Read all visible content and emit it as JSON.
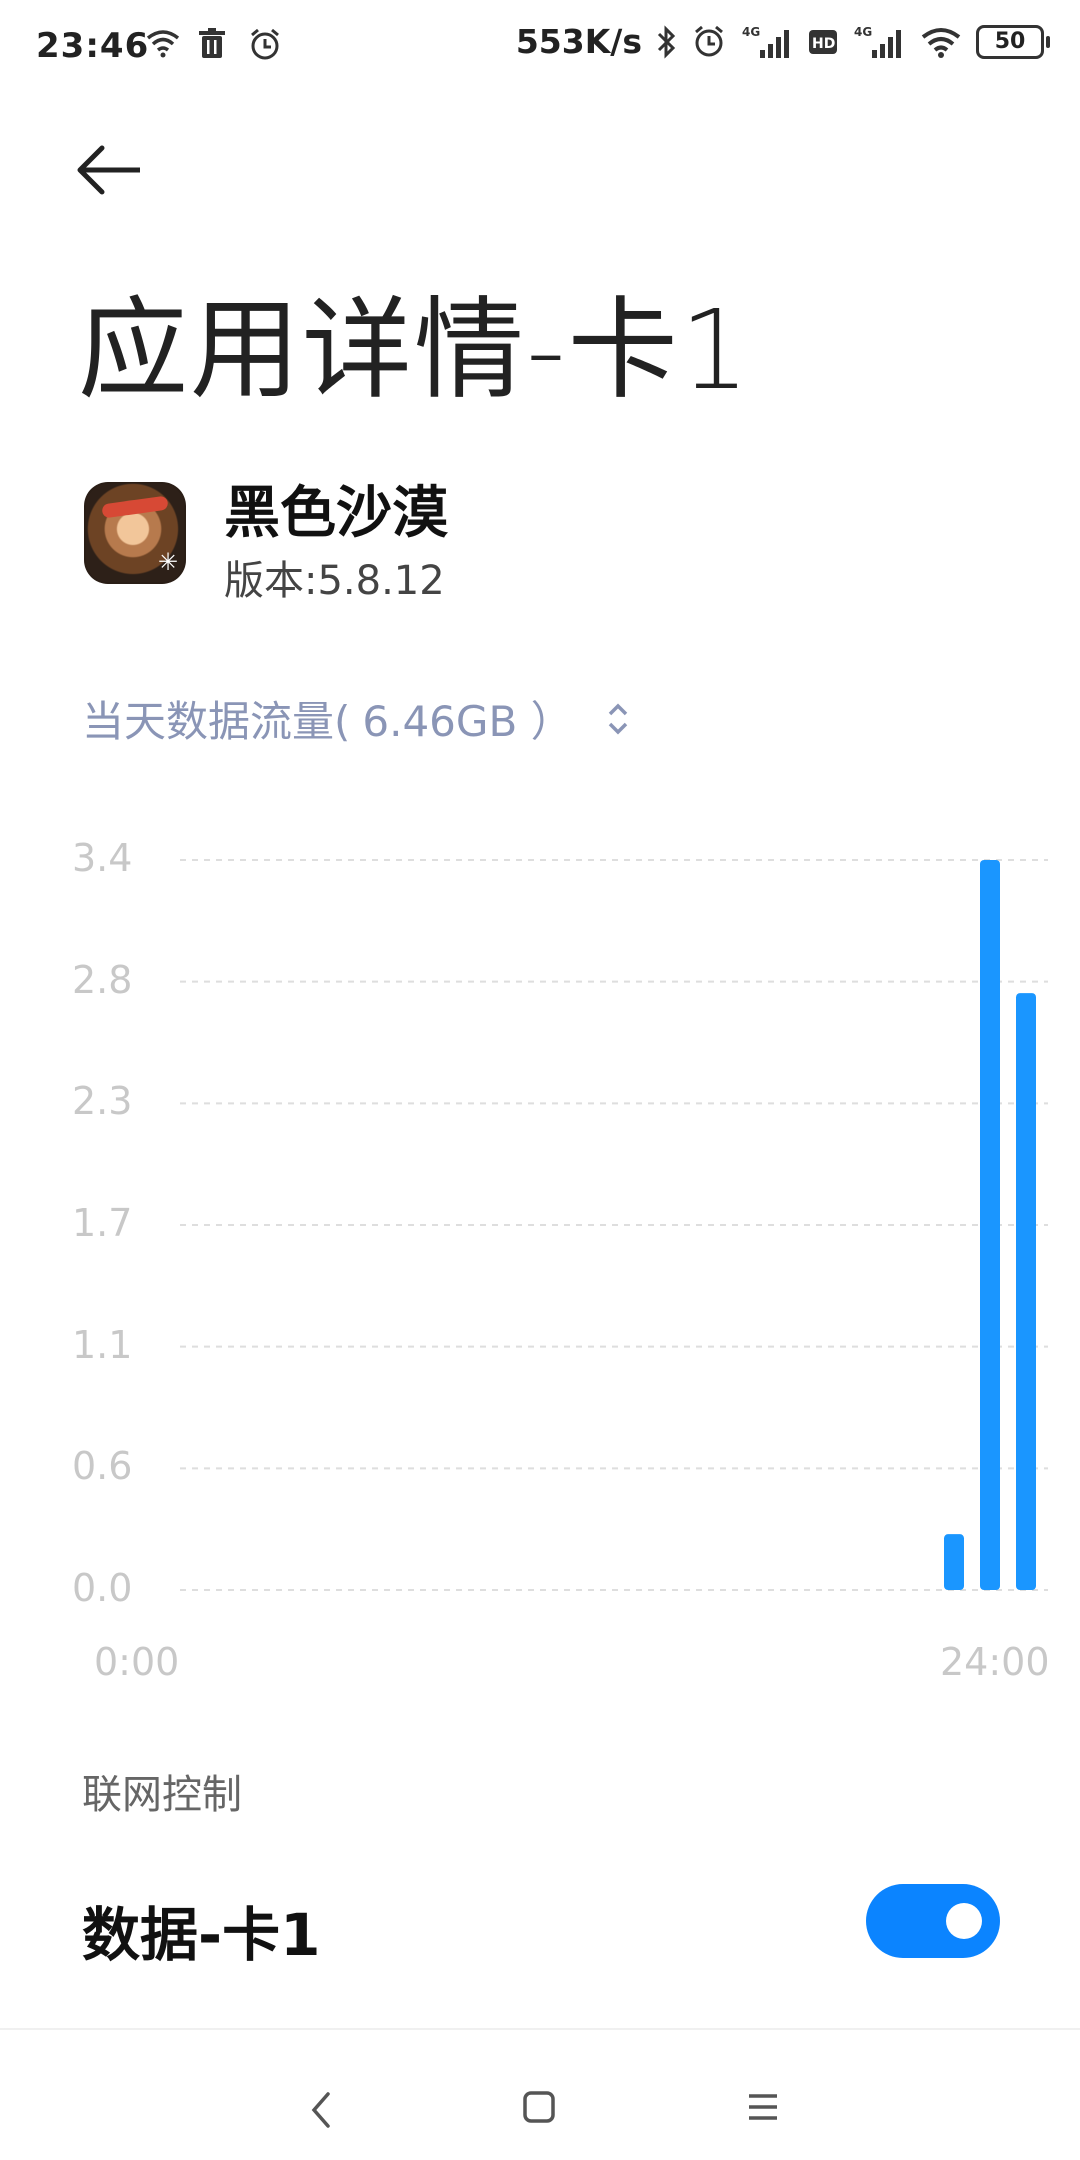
{
  "status_bar": {
    "time": "23:46",
    "left_icons": [
      "wifi-icon",
      "trash-icon",
      "alarm-icon"
    ],
    "net_speed": "553K/s",
    "right_icons": [
      "bluetooth-icon",
      "alarm-icon",
      "signal-4g-icon",
      "hd-icon",
      "signal-4g-icon",
      "wifi-icon"
    ],
    "battery": "50"
  },
  "page": {
    "back_icon": "back-arrow-icon",
    "title": "应用详情-卡1"
  },
  "app": {
    "name": "黑色沙漠",
    "version": "版本:5.8.12"
  },
  "usage": {
    "label": "当天数据流量(",
    "value": "6.46GB ）",
    "sort_icon": "sort-updown-icon"
  },
  "chart_data": {
    "type": "bar",
    "y_ticks": [
      "3.4",
      "2.8",
      "2.3",
      "1.7",
      "1.1",
      "0.6",
      "0.0"
    ],
    "x_ticks": [
      "0:00",
      "24:00"
    ],
    "ylim": [
      0,
      3.4
    ],
    "values": [
      0.26,
      3.4,
      2.78
    ],
    "color": "#1a96ff",
    "grid": true
  },
  "control": {
    "section_label": "联网控制",
    "row_label": "数据-卡1",
    "toggle_on": true,
    "toggle_color": "#0b84ff"
  },
  "nav": {
    "icons": [
      "nav-back-icon",
      "nav-home-icon",
      "nav-menu-icon"
    ]
  }
}
